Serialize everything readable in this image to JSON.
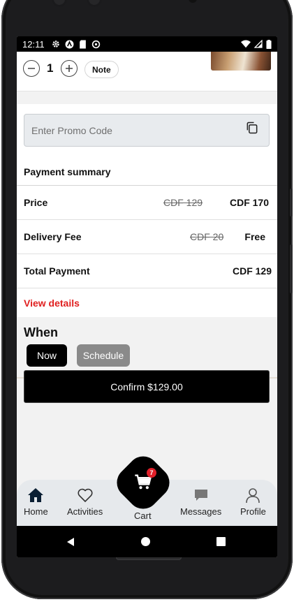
{
  "status_bar": {
    "time": "12:11"
  },
  "cart_item": {
    "quantity": "1",
    "note_label": "Note"
  },
  "promo": {
    "placeholder": "Enter Promo Code"
  },
  "payment_summary": {
    "title": "Payment summary",
    "rows": [
      {
        "label": "Price",
        "original": "CDF 129",
        "value": "CDF 170"
      },
      {
        "label": "Delivery Fee",
        "original": "CDF 20",
        "value": "Free"
      },
      {
        "label": "Total Payment",
        "original": "",
        "value": "CDF 129"
      }
    ],
    "view_details": "View details"
  },
  "when": {
    "title": "When",
    "now_label": "Now",
    "schedule_label": "Schedule",
    "selected": "Now"
  },
  "confirm": {
    "label": "Confirm $129.00"
  },
  "bottom_nav": {
    "home": "Home",
    "activities": "Activities",
    "cart": "Cart",
    "cart_badge": "7",
    "messages": "Messages",
    "profile": "Profile"
  },
  "colors": {
    "accent_red": "#e02020",
    "primary_black": "#000000",
    "nav_background": "#e6e9ec",
    "schedule_gray": "#8a8a8a"
  }
}
